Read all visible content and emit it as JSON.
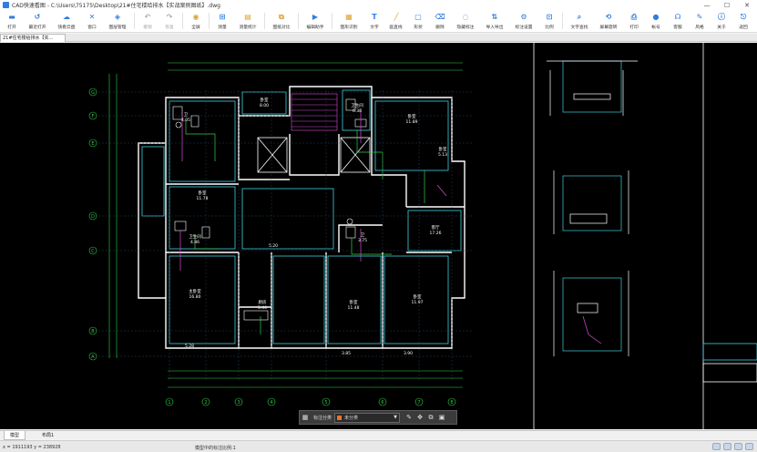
{
  "window": {
    "title": "CAD快速看图 - C:\\Users\\75175\\Desktop\\21#住宅楼给排水【实战案例图纸】.dwg",
    "minimize": "—",
    "maximize": "☐",
    "close": "✕"
  },
  "toolbar": {
    "items": [
      {
        "label": "打开",
        "icon": "folder-icon",
        "glyph": "▬",
        "color": "#2f7de1",
        "disabled": false
      },
      {
        "label": "最近打开",
        "icon": "history-icon",
        "glyph": "↺",
        "color": "#2f7de1",
        "disabled": false
      },
      {
        "label": "快看云盘",
        "icon": "cloud-icon",
        "glyph": "☁",
        "color": "#2f7de1",
        "disabled": false
      },
      {
        "label": "窗口",
        "icon": "window-icon",
        "glyph": "✕",
        "color": "#2f7de1",
        "disabled": false
      },
      {
        "label": "图层管理",
        "icon": "layers-icon",
        "glyph": "◈",
        "color": "#2f7de1",
        "disabled": false
      },
      {
        "label": "撤销",
        "icon": "undo-icon",
        "glyph": "↶",
        "color": "#aaaaaa",
        "disabled": true
      },
      {
        "label": "恢复",
        "icon": "redo-icon",
        "glyph": "↷",
        "color": "#aaaaaa",
        "disabled": true
      },
      {
        "label": "全屏",
        "icon": "fullscreen-icon",
        "glyph": "◉",
        "color": "#e0a02a",
        "disabled": false
      },
      {
        "label": "测量",
        "icon": "measure-icon",
        "glyph": "⊞",
        "color": "#2f7de1",
        "disabled": false
      },
      {
        "label": "测量统计",
        "icon": "measure-stats-icon",
        "glyph": "▤",
        "color": "#e0a02a",
        "disabled": false
      },
      {
        "label": "图纸对比",
        "icon": "compare-icon",
        "glyph": "⧉",
        "color": "#e0a02a",
        "disabled": false
      },
      {
        "label": "编辑助手",
        "icon": "edit-assistant-icon",
        "glyph": "▶",
        "color": "#2f7de1",
        "disabled": false
      },
      {
        "label": "图形识别",
        "icon": "shape-recognition-icon",
        "glyph": "▦",
        "color": "#e0a02a",
        "disabled": false
      },
      {
        "label": "文字",
        "icon": "text-icon",
        "glyph": "T",
        "color": "#2f7de1",
        "disabled": false
      },
      {
        "label": "画直线",
        "icon": "line-icon",
        "glyph": "╱",
        "color": "#e0a02a",
        "disabled": false
      },
      {
        "label": "形状",
        "icon": "shape-icon",
        "glyph": "▢",
        "color": "#2f7de1",
        "disabled": false
      },
      {
        "label": "删除",
        "icon": "delete-icon",
        "glyph": "⌫",
        "color": "#2f7de1",
        "disabled": false
      },
      {
        "label": "隐藏标注",
        "icon": "hide-annotation-icon",
        "glyph": "◌",
        "color": "#2f7de1",
        "disabled": false
      },
      {
        "label": "导入导出",
        "icon": "import-export-icon",
        "glyph": "⇅",
        "color": "#2f7de1",
        "disabled": false
      },
      {
        "label": "标注设置",
        "icon": "annotation-settings-icon",
        "glyph": "⚙",
        "color": "#2f7de1",
        "disabled": false
      },
      {
        "label": "比例",
        "icon": "scale-icon",
        "glyph": "⊡",
        "color": "#2f7de1",
        "disabled": false
      },
      {
        "label": "文字查找",
        "icon": "text-search-icon",
        "glyph": "⌕",
        "color": "#2f7de1",
        "disabled": false
      },
      {
        "label": "屏幕旋转",
        "icon": "rotate-screen-icon",
        "glyph": "⟲",
        "color": "#2f7de1",
        "disabled": false
      },
      {
        "label": "打印",
        "icon": "print-icon",
        "glyph": "⎙",
        "color": "#2f7de1",
        "disabled": false
      },
      {
        "label": "帐号",
        "icon": "account-icon",
        "glyph": "●",
        "color": "#2f7de1",
        "disabled": false
      },
      {
        "label": "客服",
        "icon": "headset-icon",
        "glyph": "☊",
        "color": "#2f7de1",
        "disabled": false
      },
      {
        "label": "风格",
        "icon": "style-icon",
        "glyph": "✎",
        "color": "#2f7de1",
        "disabled": false
      },
      {
        "label": "关于",
        "icon": "info-icon",
        "glyph": "ⓘ",
        "color": "#2f7de1",
        "disabled": false
      },
      {
        "label": "返回",
        "icon": "back-icon",
        "glyph": "⎋",
        "color": "#2f7de1",
        "disabled": false
      }
    ]
  },
  "document_tab": {
    "label": "21#住宅楼给排水【实..."
  },
  "drawing": {
    "rooms": [
      {
        "name": "卧室",
        "area": "8.00"
      },
      {
        "name": "卫生间",
        "area": "6.38"
      },
      {
        "name": "卧室",
        "area": "11.89"
      },
      {
        "name": "卫",
        "area": "4.05"
      },
      {
        "name": "卧室",
        "area": "5.13"
      },
      {
        "name": "卧室",
        "area": "11.78"
      },
      {
        "name": "客厅",
        "area": "17.26"
      },
      {
        "name": "卫生间",
        "area": "4.86"
      },
      {
        "name": "",
        "area": "5.20"
      },
      {
        "name": "卫",
        "area": "3.75"
      },
      {
        "name": "主卧室",
        "area": "16.80"
      },
      {
        "name": "卧室",
        "area": "11.48"
      },
      {
        "name": "卧室",
        "area": "11.97"
      },
      {
        "name": "厨房",
        "area": "5.44"
      },
      {
        "name": "",
        "area": "5.28"
      },
      {
        "name": "",
        "area": "3.85"
      },
      {
        "name": "",
        "area": "3.90"
      }
    ],
    "axes_left": [
      "G",
      "F",
      "E",
      "D",
      "C",
      "B",
      "A"
    ],
    "axes_bottom": [
      "1",
      "2",
      "3",
      "4",
      "5",
      "6",
      "7",
      "8"
    ]
  },
  "floatbar": {
    "label": "标注分类",
    "selected": "未分类"
  },
  "layout_tabs": {
    "model": "模型",
    "layout1": "布局1"
  },
  "status": {
    "coordinates": "x = 1911193  y = 238928",
    "scale_text": "模型中的标注比例:1"
  }
}
